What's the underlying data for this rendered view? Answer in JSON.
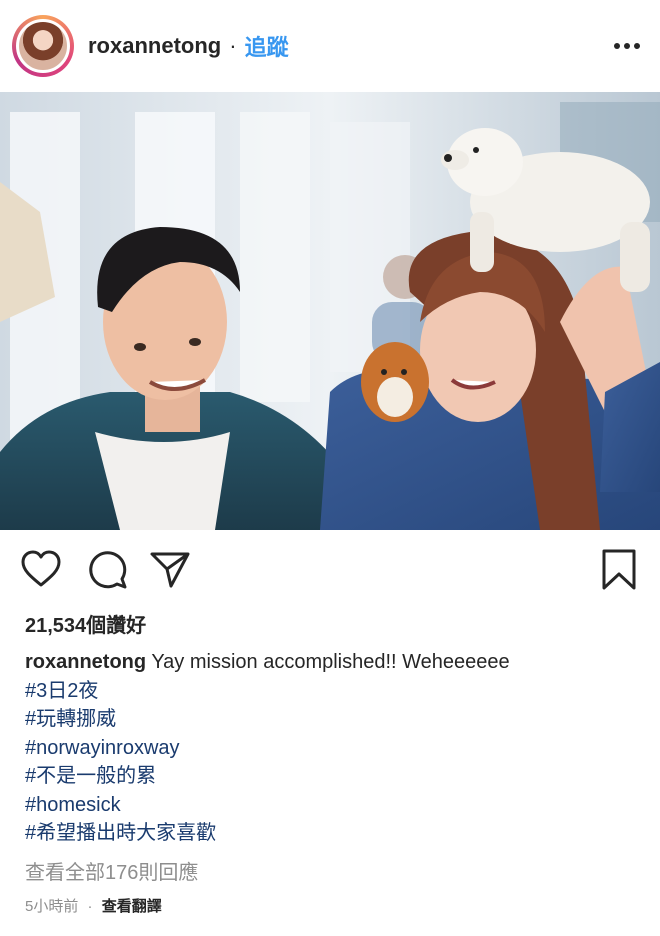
{
  "header": {
    "username": "roxannetong",
    "separator": "·",
    "follow_label": "追蹤",
    "more_icon": "more-horizontal-icon"
  },
  "post": {
    "likes_text": "21,534個讚好",
    "caption_user": "roxannetong",
    "caption_text": "Yay mission accomplished!! Weheeeeee",
    "hashtags": [
      "#3日2夜",
      "#玩轉挪威",
      "#norwayinroxway",
      "#不是一般的累",
      "#homesick",
      "#希望播出時大家喜歡"
    ],
    "view_comments": "查看全部176則回應",
    "time_ago": "5小時前",
    "footer_separator": "·",
    "translate_label": "查看翻譯"
  },
  "icons": {
    "like": "heart-icon",
    "comment": "comment-icon",
    "share": "share-icon",
    "save": "bookmark-icon"
  },
  "colors": {
    "link_blue": "#3897f0",
    "hashtag": "#1a3b6e",
    "secondary_text": "#8e8e8e",
    "primary_text": "#262626"
  }
}
